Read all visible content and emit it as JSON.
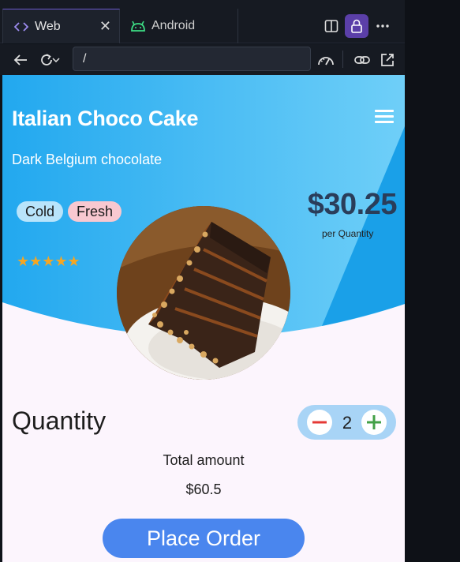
{
  "browser": {
    "tabs": [
      {
        "label": "Web",
        "icon": "code-icon"
      },
      {
        "label": "Android",
        "icon": "android-icon"
      }
    ],
    "address": "/"
  },
  "app": {
    "title": "Italian Choco Cake",
    "subtitle": "Dark Belgium chocolate",
    "tags": [
      "Cold",
      "Fresh"
    ],
    "rating": 5,
    "rating_stars": "★★★★★",
    "price": "$30.25",
    "price_unit": "per Quantity",
    "quantity_label": "Quantity",
    "quantity": "2",
    "total_label": "Total amount",
    "total_value": "$60.5",
    "order_button": "Place Order"
  },
  "colors": {
    "hero_light": "#5cc6f8",
    "hero_mid": "#1fa7ee",
    "price": "#2a3d5a",
    "order_button": "#4a86ee",
    "stepper": "#a8d4f6",
    "minus": "#e53935",
    "plus": "#43a047",
    "star": "#f5a623",
    "accent_lock": "#5b3fa8"
  }
}
